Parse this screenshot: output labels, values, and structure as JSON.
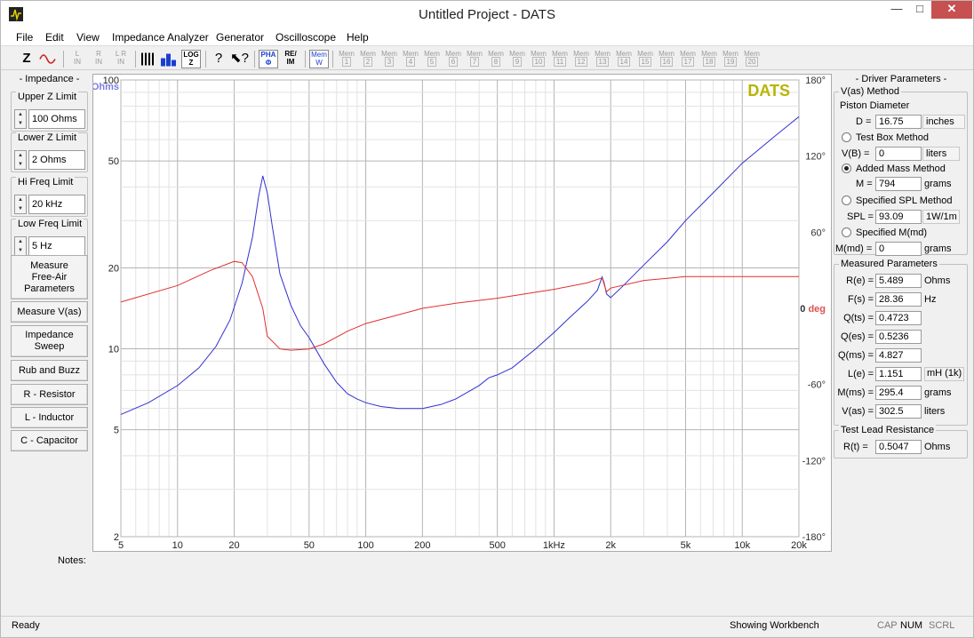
{
  "window": {
    "title": "Untitled Project - DATS",
    "min": "—",
    "max": "□",
    "close": "✕"
  },
  "menu": [
    "File",
    "Edit",
    "View",
    "Impedance Analyzer",
    "Generator",
    "Oscilloscope",
    "Help"
  ],
  "toolbar": {
    "z": "Z",
    "l_in": [
      "L",
      "IN"
    ],
    "r_in": [
      "R",
      "IN"
    ],
    "lr_in": [
      "L R",
      "IN"
    ],
    "log_z": [
      "LOG",
      "Z"
    ],
    "pha": [
      "PHA",
      "Φ"
    ],
    "re_im": [
      "RE/",
      "IM"
    ],
    "mem_w": [
      "Mem",
      "W"
    ],
    "mem": [
      "1",
      "2",
      "3",
      "4",
      "5",
      "6",
      "7",
      "8",
      "9",
      "10",
      "11",
      "12",
      "13",
      "14",
      "15",
      "16",
      "17",
      "18",
      "19",
      "20"
    ],
    "mem_label": "Mem"
  },
  "left_panel": {
    "title": "- Impedance -",
    "upper_z": {
      "label": "Upper Z Limit",
      "value": "100 Ohms"
    },
    "lower_z": {
      "label": "Lower Z Limit",
      "value": "2 Ohms"
    },
    "hi_freq": {
      "label": "Hi Freq Limit",
      "value": "20 kHz"
    },
    "low_freq": {
      "label": "Low Freq Limit",
      "value": "5 Hz"
    },
    "buttons": [
      "Measure Free-Air Parameters",
      "Measure V(as)",
      "Impedance Sweep",
      "Rub and Buzz",
      "R - Resistor",
      "L - Inductor",
      "C - Capacitor"
    ]
  },
  "chart_data": {
    "type": "line",
    "logo": "DATS",
    "xscale": "log",
    "xlim": [
      5,
      20000
    ],
    "x_ticks": [
      "5",
      "10",
      "20",
      "50",
      "100",
      "200",
      "500",
      "1kHz",
      "2k",
      "5k",
      "10k",
      "20k"
    ],
    "ylabel": "Ohms",
    "yscale": "log",
    "ylim": [
      2,
      100
    ],
    "y_ticks": [
      "100",
      "50",
      "20",
      "10",
      "5",
      "2"
    ],
    "y2label": "0 deg",
    "y2lim": [
      -180,
      180
    ],
    "y2_ticks": [
      "180°",
      "120°",
      "60°",
      "0 deg",
      "-60°",
      "-120°",
      "-180°"
    ],
    "grid": true,
    "series": [
      {
        "color": "#3030d0",
        "axis": "y",
        "x": [
          5,
          7,
          10,
          13,
          16,
          19,
          22,
          25,
          27,
          28.36,
          30,
          32,
          35,
          40,
          45,
          50,
          60,
          70,
          80,
          90,
          100,
          120,
          150,
          200,
          250,
          300,
          400,
          450,
          500,
          600,
          800,
          1000,
          1200,
          1500,
          1700,
          1800,
          1850,
          1900,
          2000,
          2300,
          3000,
          4000,
          5000,
          7000,
          10000,
          15000,
          20000
        ],
        "y": [
          5.7,
          6.3,
          7.3,
          8.5,
          10.2,
          12.8,
          17.5,
          26,
          37,
          44,
          38,
          28,
          19,
          14.5,
          12.2,
          11,
          8.8,
          7.5,
          6.8,
          6.5,
          6.3,
          6.1,
          6.0,
          6.0,
          6.2,
          6.5,
          7.3,
          7.8,
          8.0,
          8.5,
          10,
          11.5,
          13,
          15,
          16.5,
          18.5,
          17.5,
          16,
          15.5,
          17,
          20.5,
          25,
          30,
          38,
          49,
          62,
          73
        ]
      },
      {
        "color": "#e03030",
        "axis": "y2",
        "x": [
          5,
          10,
          15,
          20,
          22,
          25,
          28.36,
          30,
          35,
          40,
          50,
          60,
          80,
          100,
          150,
          200,
          300,
          500,
          1000,
          1500,
          1800,
          1900,
          2000,
          3000,
          5000,
          10000,
          20000
        ],
        "y": [
          5,
          18,
          30,
          37,
          36,
          25,
          0,
          -22,
          -32,
          -33,
          -32,
          -28,
          -18,
          -12,
          -5,
          0,
          4,
          8,
          15,
          20,
          24,
          13,
          16,
          22,
          25,
          25,
          25
        ]
      }
    ]
  },
  "right_panel": {
    "title": "- Driver Parameters -",
    "vas_method": {
      "label": "V(as) Method",
      "piston": "Piston Diameter",
      "d_label": "D =",
      "d_value": "16.75",
      "d_unit": "inches",
      "testbox": "Test Box Method",
      "vb_label": "V(B) =",
      "vb_value": "0",
      "vb_unit": "liters",
      "added": "Added Mass Method",
      "m_label": "M =",
      "m_value": "794",
      "m_unit": "grams",
      "spl_method": "Specified SPL Method",
      "spl_label": "SPL =",
      "spl_value": "93.09",
      "spl_unit": "1W/1m",
      "mmd_method": "Specified M(md)",
      "mmd_label": "M(md) =",
      "mmd_value": "0",
      "mmd_unit": "grams",
      "selected": "Added Mass Method"
    },
    "measured": {
      "label": "Measured Parameters",
      "rows": [
        {
          "name": "R(e) =",
          "value": "5.489",
          "unit": "Ohms"
        },
        {
          "name": "F(s) =",
          "value": "28.36",
          "unit": "Hz"
        },
        {
          "name": "Q(ts) =",
          "value": "0.4723",
          "unit": ""
        },
        {
          "name": "Q(es) =",
          "value": "0.5236",
          "unit": ""
        },
        {
          "name": "Q(ms) =",
          "value": "4.827",
          "unit": ""
        },
        {
          "name": "L(e) =",
          "value": "1.151",
          "unit": "mH (1k)"
        },
        {
          "name": "M(ms) =",
          "value": "295.4",
          "unit": "grams"
        },
        {
          "name": "V(as) =",
          "value": "302.5",
          "unit": "liters"
        }
      ]
    },
    "lead": {
      "label": "Test Lead Resistance",
      "name": "R(t) =",
      "value": "0.5047",
      "unit": "Ohms"
    }
  },
  "notes_label": "Notes:",
  "status": {
    "left": "Ready",
    "workbench": "Showing Workbench",
    "caps": "CAP",
    "num": "NUM",
    "scrl": "SCRL"
  },
  "colors": {
    "impedance": "#3030d0",
    "phase": "#e03030",
    "logo": "#b8b400"
  }
}
